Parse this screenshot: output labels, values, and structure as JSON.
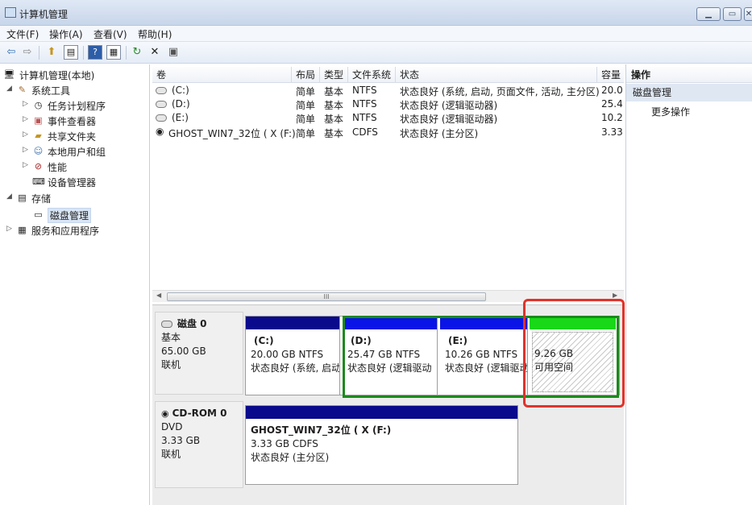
{
  "window": {
    "title": "计算机管理",
    "buttons": [
      "▁",
      "▭",
      "✕"
    ]
  },
  "menu": [
    "文件(F)",
    "操作(A)",
    "查看(V)",
    "帮助(H)"
  ],
  "toolbar": {
    "icons": [
      "back-arrow-icon",
      "forward-arrow-icon",
      "up-folder-icon",
      "show-hide-tree-icon",
      "help-icon",
      "properties-icon",
      "refresh-icon",
      "delete-icon",
      "export-icon"
    ],
    "glyphs": {
      "back": "⇦",
      "forward": "⇨",
      "up": "⬆",
      "tree": "▤",
      "help": "?",
      "props": "▦",
      "refresh": "↻",
      "delete": "✕",
      "export": "▣"
    }
  },
  "tree": {
    "root": "计算机管理(本地)",
    "system_tools": "系统工具",
    "task_scheduler": "任务计划程序",
    "event_viewer": "事件查看器",
    "shared_folders": "共享文件夹",
    "local_users": "本地用户和组",
    "performance": "性能",
    "device_manager": "设备管理器",
    "storage": "存储",
    "disk_management": "磁盘管理",
    "services_apps": "服务和应用程序"
  },
  "volumes": {
    "headers": [
      "卷",
      "布局",
      "类型",
      "文件系统",
      "状态",
      "容量"
    ],
    "rows": [
      {
        "name": "(C:)",
        "layout": "简单",
        "type": "基本",
        "fs": "NTFS",
        "status": "状态良好 (系统, 启动, 页面文件, 活动, 主分区)",
        "cap": "20.0"
      },
      {
        "name": "(D:)",
        "layout": "简单",
        "type": "基本",
        "fs": "NTFS",
        "status": "状态良好 (逻辑驱动器)",
        "cap": "25.4"
      },
      {
        "name": "(E:)",
        "layout": "简单",
        "type": "基本",
        "fs": "NTFS",
        "status": "状态良好 (逻辑驱动器)",
        "cap": "10.2"
      },
      {
        "name": "GHOST_WIN7_32位 ( X (F:)",
        "layout": "简单",
        "type": "基本",
        "fs": "CDFS",
        "status": "状态良好 (主分区)",
        "cap": "3.33"
      }
    ],
    "scroll_thumb": "III"
  },
  "disks": {
    "disk0": {
      "name": "磁盘 0",
      "kind": "基本",
      "size": "65.00 GB",
      "state": "联机",
      "partitions": [
        {
          "name": "(C:)",
          "size": "20.00 GB NTFS",
          "status": "状态良好 (系统, 启动",
          "color": "#0a0a8c"
        },
        {
          "name": "(D:)",
          "size": "25.47 GB NTFS",
          "status": "状态良好 (逻辑驱动",
          "color": "#0b14e6"
        },
        {
          "name": "(E:)",
          "size": "10.26 GB NTFS",
          "status": "状态良好 (逻辑驱动",
          "color": "#0b14e6"
        },
        {
          "size": "9.26 GB",
          "status": "可用空间",
          "color": "#18d818"
        }
      ]
    },
    "cdrom0": {
      "name": "CD-ROM 0",
      "kind": "DVD",
      "size": "3.33 GB",
      "state": "联机",
      "partition": {
        "name": "GHOST_WIN7_32位 ( X  (F:)",
        "size": "3.33 GB CDFS",
        "status": "状态良好 (主分区)",
        "color": "#0a0a8c"
      }
    }
  },
  "actions": {
    "header": "操作",
    "section": "磁盘管理",
    "more": "更多操作"
  },
  "colors": {
    "highlight_green": "#1b8a1b",
    "highlight_red": "#e0332b"
  }
}
